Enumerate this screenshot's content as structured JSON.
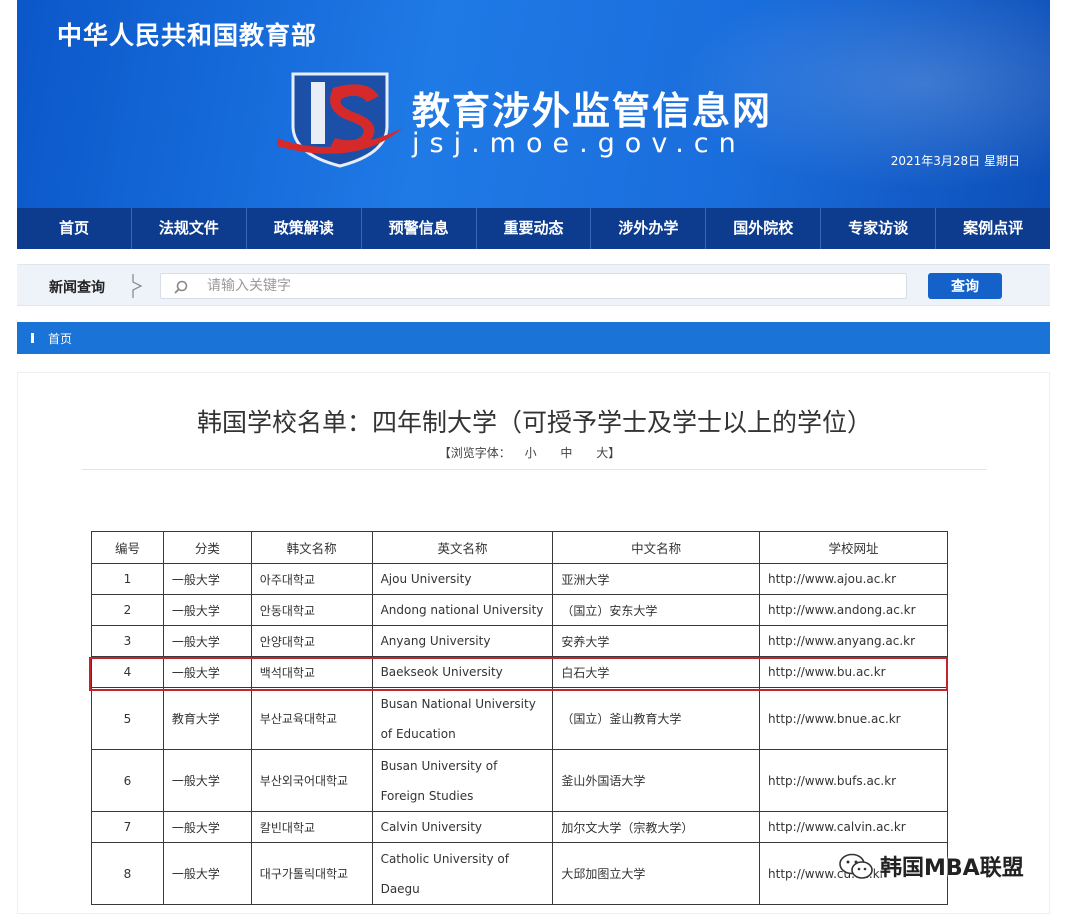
{
  "header": {
    "ministry": "中华人民共和国教育部",
    "site_name": "教育涉外监管信息网",
    "site_url": "jsj.moe.gov.cn",
    "date": "2021年3月28日  星期日"
  },
  "nav": [
    "首页",
    "法规文件",
    "政策解读",
    "预警信息",
    "重要动态",
    "涉外办学",
    "国外院校",
    "专家访谈",
    "案例点评"
  ],
  "search": {
    "label": "新闻查询",
    "placeholder": "请输入关键字",
    "button": "查询"
  },
  "breadcrumb": "首页",
  "article": {
    "title": "韩国学校名单：四年制大学（可授予学士及学士以上的学位）",
    "font_size_prefix": "【浏览字体：",
    "font_small": "小",
    "font_medium": "中",
    "font_large": "大】"
  },
  "table": {
    "headers": [
      "编号",
      "分类",
      "韩文名称",
      "英文名称",
      "中文名称",
      "学校网址"
    ],
    "rows": [
      [
        "1",
        "一般大学",
        "아주대학교",
        "Ajou  University",
        "亚洲大学",
        "http://www.ajou.ac.kr"
      ],
      [
        "2",
        "一般大学",
        "안동대학교",
        "Andong national  University",
        "（国立）安东大学",
        "http://www.andong.ac.kr"
      ],
      [
        "3",
        "一般大学",
        "안양대학교",
        "Anyang  University",
        "安养大学",
        "http://www.anyang.ac.kr"
      ],
      [
        "4",
        "一般大学",
        "백석대학교",
        "Baekseok  University",
        "白石大学",
        "http://www.bu.ac.kr"
      ],
      [
        "5",
        "教育大学",
        "부산교육대학교",
        "Busan National  University of Education",
        "（国立）釜山教育大学",
        "http://www.bnue.ac.kr"
      ],
      [
        "6",
        "一般大学",
        "부산외국어대학교",
        "Busan  University of Foreign Studies",
        "釜山外国语大学",
        "http://www.bufs.ac.kr"
      ],
      [
        "7",
        "一般大学",
        "칼빈대학교",
        "Calvin  University",
        "加尔文大学（宗教大学）",
        "http://www.calvin.ac.kr"
      ],
      [
        "8",
        "一般大学",
        "대구가톨릭대학교",
        "Catholic    University    of Daegu",
        "大邱加图立大学",
        "http://www.cu.ac.kr"
      ]
    ]
  },
  "watermark": "韩国MBA联盟",
  "colors": {
    "banner": "#1a6ddc",
    "nav": "#0d3b8e",
    "crumb": "#1a73d6",
    "search_button": "#1461c9",
    "highlight": "#c4242b"
  }
}
